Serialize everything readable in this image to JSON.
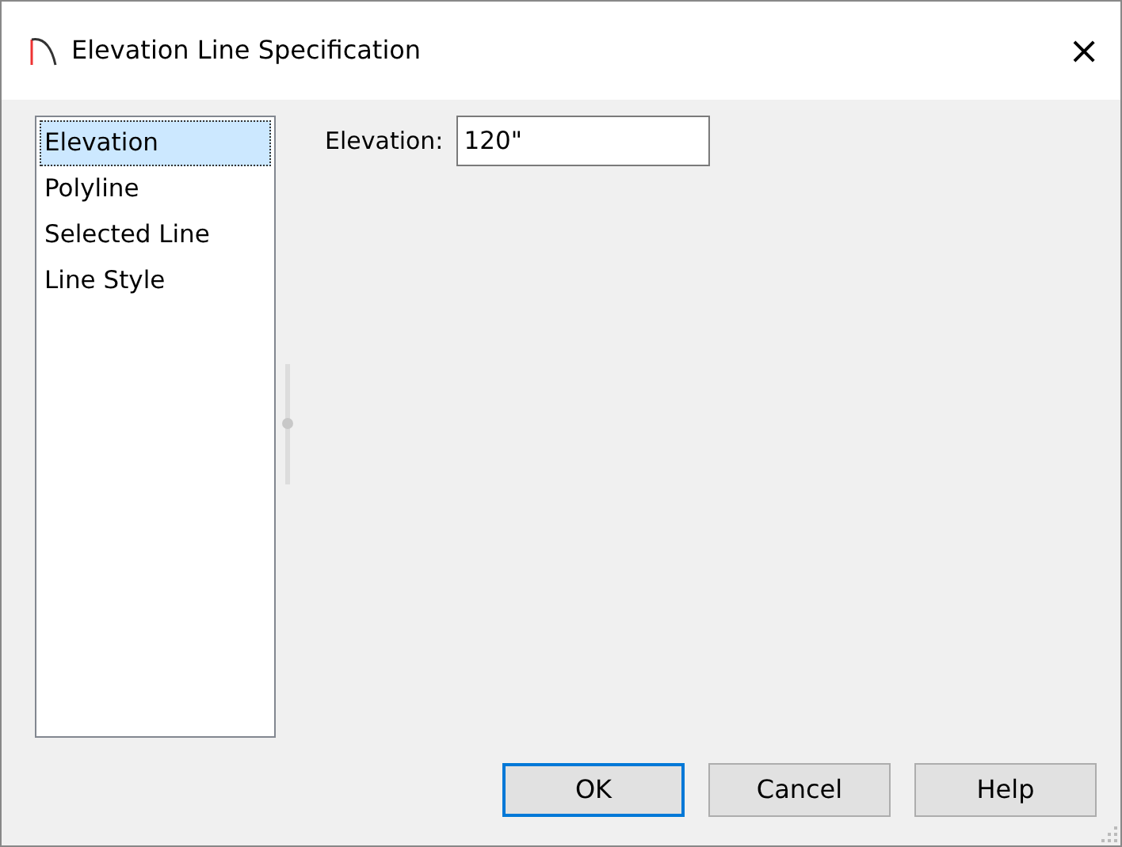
{
  "window": {
    "title": "Elevation Line Specification",
    "close": "×"
  },
  "sidebar": {
    "items": [
      {
        "label": "Elevation",
        "selected": true
      },
      {
        "label": "Polyline",
        "selected": false
      },
      {
        "label": "Selected Line",
        "selected": false
      },
      {
        "label": "Line Style",
        "selected": false
      }
    ]
  },
  "fields": [
    {
      "label": "Elevation:",
      "value": "120\""
    }
  ],
  "buttons": [
    {
      "label": "OK",
      "default": true
    },
    {
      "label": "Cancel",
      "default": false
    },
    {
      "label": "Help",
      "default": false
    }
  ]
}
